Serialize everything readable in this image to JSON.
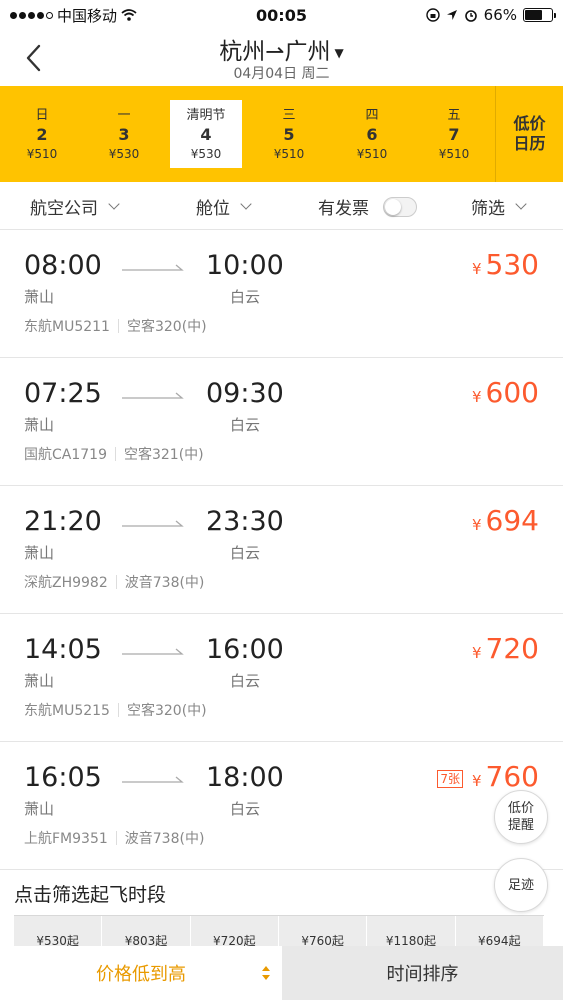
{
  "status_bar": {
    "carrier": "中国移动",
    "time": "00:05",
    "battery": "66%",
    "battery_level": 0.66
  },
  "header": {
    "title": "杭州⇀广州",
    "date": "04月04日 周二"
  },
  "date_strip": {
    "days": [
      {
        "dow": "日",
        "day": "2",
        "price": "¥510"
      },
      {
        "dow": "一",
        "day": "3",
        "price": "¥530"
      },
      {
        "dow": "清明节",
        "day": "4",
        "price": "¥530"
      },
      {
        "dow": "三",
        "day": "5",
        "price": "¥510"
      },
      {
        "dow": "四",
        "day": "6",
        "price": "¥510"
      },
      {
        "dow": "五",
        "day": "7",
        "price": "¥510"
      }
    ],
    "selected_index": 2,
    "low_calendar_line1": "低价",
    "low_calendar_line2": "日历"
  },
  "filters": {
    "airline": "航空公司",
    "cabin": "舱位",
    "invoice": "有发票",
    "invoice_toggle_on": false,
    "filter": "筛选"
  },
  "flights": [
    {
      "dep": "08:00",
      "arr": "10:00",
      "dep_airport": "萧山",
      "arr_airport": "白云",
      "flight_no": "东航MU5211",
      "aircraft": "空客320(中)",
      "yen": "¥",
      "price": "530",
      "badge": ""
    },
    {
      "dep": "07:25",
      "arr": "09:30",
      "dep_airport": "萧山",
      "arr_airport": "白云",
      "flight_no": "国航CA1719",
      "aircraft": "空客321(中)",
      "yen": "¥",
      "price": "600",
      "badge": ""
    },
    {
      "dep": "21:20",
      "arr": "23:30",
      "dep_airport": "萧山",
      "arr_airport": "白云",
      "flight_no": "深航ZH9982",
      "aircraft": "波音738(中)",
      "yen": "¥",
      "price": "694",
      "badge": ""
    },
    {
      "dep": "14:05",
      "arr": "16:00",
      "dep_airport": "萧山",
      "arr_airport": "白云",
      "flight_no": "东航MU5215",
      "aircraft": "空客320(中)",
      "yen": "¥",
      "price": "720",
      "badge": ""
    },
    {
      "dep": "16:05",
      "arr": "18:00",
      "dep_airport": "萧山",
      "arr_airport": "白云",
      "flight_no": "上航FM9351",
      "aircraft": "波音738(中)",
      "yen": "¥",
      "price": "760",
      "badge": "7张"
    }
  ],
  "time_filter": {
    "title": "点击筛选起飞时段",
    "slots": [
      "¥530起",
      "¥803起",
      "¥720起",
      "¥760起",
      "¥1180起",
      "¥694起"
    ]
  },
  "float_buttons": {
    "price_alert_line1": "低价",
    "price_alert_line2": "提醒",
    "history": "足迹"
  },
  "bottom_tabs": {
    "price_sort": "价格低到高",
    "time_sort": "时间排序"
  },
  "colors": {
    "accent_yellow": "#ffc300",
    "price_red": "#fc5a2e",
    "active_tab": "#e99a00"
  }
}
